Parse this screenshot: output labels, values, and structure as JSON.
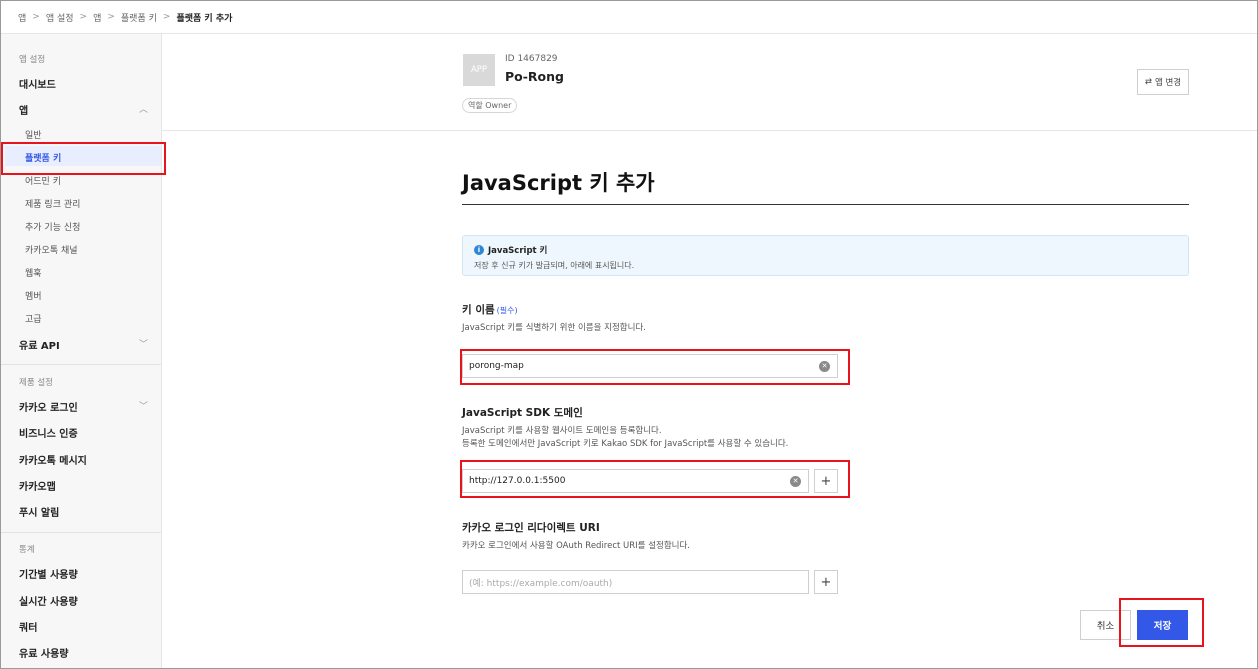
{
  "breadcrumb": [
    "앱",
    "앱 설정",
    "앱",
    "플랫폼 키",
    "플랫폼 키 추가"
  ],
  "sidebar": {
    "group_app_settings": "앱 설정",
    "dashboard": "대시보드",
    "app": "앱",
    "app_items": [
      "일반",
      "플랫폼 키",
      "어드민 키",
      "제품 링크 관리",
      "추가 기능 신청",
      "카카오톡 채널",
      "웹훅",
      "멤버",
      "고급"
    ],
    "paid_api": "유료 API",
    "group_product_settings": "제품 설정",
    "product_items": [
      "카카오 로그인",
      "비즈니스 인증",
      "카카오톡 메시지",
      "카카오맵",
      "푸시 알림"
    ],
    "group_stats": "통계",
    "stats_items": [
      "기간별 사용량",
      "실시간 사용량",
      "쿼터",
      "유료 사용량"
    ]
  },
  "app_info": {
    "thumb": "APP",
    "id": "ID 1467829",
    "name": "Po-Rong",
    "role": "역할 Owner",
    "change_button": "앱 변경"
  },
  "page": {
    "title": "JavaScript 키 추가",
    "notice_title": "JavaScript 키",
    "notice_text": "저장 후 신규 키가 발급되며, 아래에 표시됩니다."
  },
  "fields": {
    "key_name": {
      "label": "키 이름",
      "required": "(필수)",
      "desc": "JavaScript 키를 식별하기 위한 이름을 지정합니다.",
      "value": "porong-map"
    },
    "sdk_domain": {
      "label": "JavaScript SDK 도메인",
      "desc1": "JavaScript 키를 사용할 웹사이트 도메인을 등록합니다.",
      "desc2": "등록한 도메인에서만 JavaScript 키로 Kakao SDK for JavaScript를 사용할 수 있습니다.",
      "value": "http://127.0.0.1:5500"
    },
    "redirect_uri": {
      "label": "카카오 로그인 리다이렉트 URI",
      "desc": "카카오 로그인에서 사용할 OAuth Redirect URI를 설정합니다.",
      "placeholder": "(예: https://example.com/oauth)"
    }
  },
  "buttons": {
    "cancel": "취소",
    "save": "저장"
  },
  "colors": {
    "accent": "#3358e8",
    "highlight": "#e8141b"
  }
}
